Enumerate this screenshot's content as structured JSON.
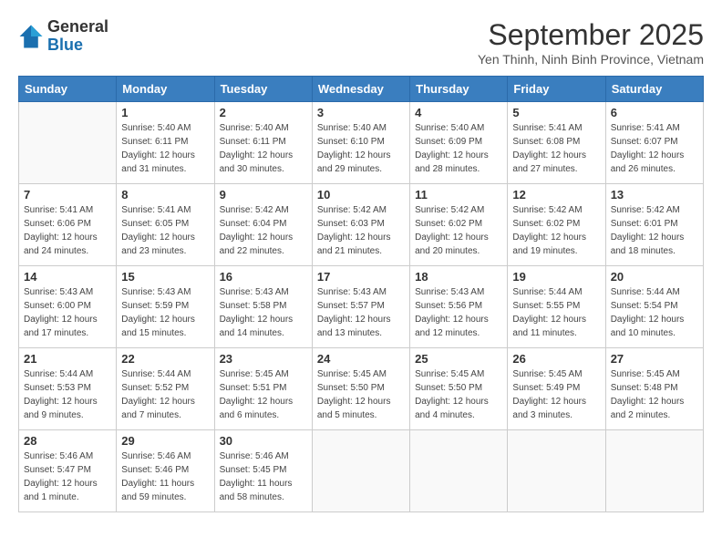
{
  "header": {
    "logo": {
      "line1": "General",
      "line2": "Blue"
    },
    "title": "September 2025",
    "location": "Yen Thinh, Ninh Binh Province, Vietnam"
  },
  "weekdays": [
    "Sunday",
    "Monday",
    "Tuesday",
    "Wednesday",
    "Thursday",
    "Friday",
    "Saturday"
  ],
  "weeks": [
    [
      {
        "day": "",
        "info": ""
      },
      {
        "day": "1",
        "info": "Sunrise: 5:40 AM\nSunset: 6:11 PM\nDaylight: 12 hours\nand 31 minutes."
      },
      {
        "day": "2",
        "info": "Sunrise: 5:40 AM\nSunset: 6:11 PM\nDaylight: 12 hours\nand 30 minutes."
      },
      {
        "day": "3",
        "info": "Sunrise: 5:40 AM\nSunset: 6:10 PM\nDaylight: 12 hours\nand 29 minutes."
      },
      {
        "day": "4",
        "info": "Sunrise: 5:40 AM\nSunset: 6:09 PM\nDaylight: 12 hours\nand 28 minutes."
      },
      {
        "day": "5",
        "info": "Sunrise: 5:41 AM\nSunset: 6:08 PM\nDaylight: 12 hours\nand 27 minutes."
      },
      {
        "day": "6",
        "info": "Sunrise: 5:41 AM\nSunset: 6:07 PM\nDaylight: 12 hours\nand 26 minutes."
      }
    ],
    [
      {
        "day": "7",
        "info": "Sunrise: 5:41 AM\nSunset: 6:06 PM\nDaylight: 12 hours\nand 24 minutes."
      },
      {
        "day": "8",
        "info": "Sunrise: 5:41 AM\nSunset: 6:05 PM\nDaylight: 12 hours\nand 23 minutes."
      },
      {
        "day": "9",
        "info": "Sunrise: 5:42 AM\nSunset: 6:04 PM\nDaylight: 12 hours\nand 22 minutes."
      },
      {
        "day": "10",
        "info": "Sunrise: 5:42 AM\nSunset: 6:03 PM\nDaylight: 12 hours\nand 21 minutes."
      },
      {
        "day": "11",
        "info": "Sunrise: 5:42 AM\nSunset: 6:02 PM\nDaylight: 12 hours\nand 20 minutes."
      },
      {
        "day": "12",
        "info": "Sunrise: 5:42 AM\nSunset: 6:02 PM\nDaylight: 12 hours\nand 19 minutes."
      },
      {
        "day": "13",
        "info": "Sunrise: 5:42 AM\nSunset: 6:01 PM\nDaylight: 12 hours\nand 18 minutes."
      }
    ],
    [
      {
        "day": "14",
        "info": "Sunrise: 5:43 AM\nSunset: 6:00 PM\nDaylight: 12 hours\nand 17 minutes."
      },
      {
        "day": "15",
        "info": "Sunrise: 5:43 AM\nSunset: 5:59 PM\nDaylight: 12 hours\nand 15 minutes."
      },
      {
        "day": "16",
        "info": "Sunrise: 5:43 AM\nSunset: 5:58 PM\nDaylight: 12 hours\nand 14 minutes."
      },
      {
        "day": "17",
        "info": "Sunrise: 5:43 AM\nSunset: 5:57 PM\nDaylight: 12 hours\nand 13 minutes."
      },
      {
        "day": "18",
        "info": "Sunrise: 5:43 AM\nSunset: 5:56 PM\nDaylight: 12 hours\nand 12 minutes."
      },
      {
        "day": "19",
        "info": "Sunrise: 5:44 AM\nSunset: 5:55 PM\nDaylight: 12 hours\nand 11 minutes."
      },
      {
        "day": "20",
        "info": "Sunrise: 5:44 AM\nSunset: 5:54 PM\nDaylight: 12 hours\nand 10 minutes."
      }
    ],
    [
      {
        "day": "21",
        "info": "Sunrise: 5:44 AM\nSunset: 5:53 PM\nDaylight: 12 hours\nand 9 minutes."
      },
      {
        "day": "22",
        "info": "Sunrise: 5:44 AM\nSunset: 5:52 PM\nDaylight: 12 hours\nand 7 minutes."
      },
      {
        "day": "23",
        "info": "Sunrise: 5:45 AM\nSunset: 5:51 PM\nDaylight: 12 hours\nand 6 minutes."
      },
      {
        "day": "24",
        "info": "Sunrise: 5:45 AM\nSunset: 5:50 PM\nDaylight: 12 hours\nand 5 minutes."
      },
      {
        "day": "25",
        "info": "Sunrise: 5:45 AM\nSunset: 5:50 PM\nDaylight: 12 hours\nand 4 minutes."
      },
      {
        "day": "26",
        "info": "Sunrise: 5:45 AM\nSunset: 5:49 PM\nDaylight: 12 hours\nand 3 minutes."
      },
      {
        "day": "27",
        "info": "Sunrise: 5:45 AM\nSunset: 5:48 PM\nDaylight: 12 hours\nand 2 minutes."
      }
    ],
    [
      {
        "day": "28",
        "info": "Sunrise: 5:46 AM\nSunset: 5:47 PM\nDaylight: 12 hours\nand 1 minute."
      },
      {
        "day": "29",
        "info": "Sunrise: 5:46 AM\nSunset: 5:46 PM\nDaylight: 11 hours\nand 59 minutes."
      },
      {
        "day": "30",
        "info": "Sunrise: 5:46 AM\nSunset: 5:45 PM\nDaylight: 11 hours\nand 58 minutes."
      },
      {
        "day": "",
        "info": ""
      },
      {
        "day": "",
        "info": ""
      },
      {
        "day": "",
        "info": ""
      },
      {
        "day": "",
        "info": ""
      }
    ]
  ]
}
